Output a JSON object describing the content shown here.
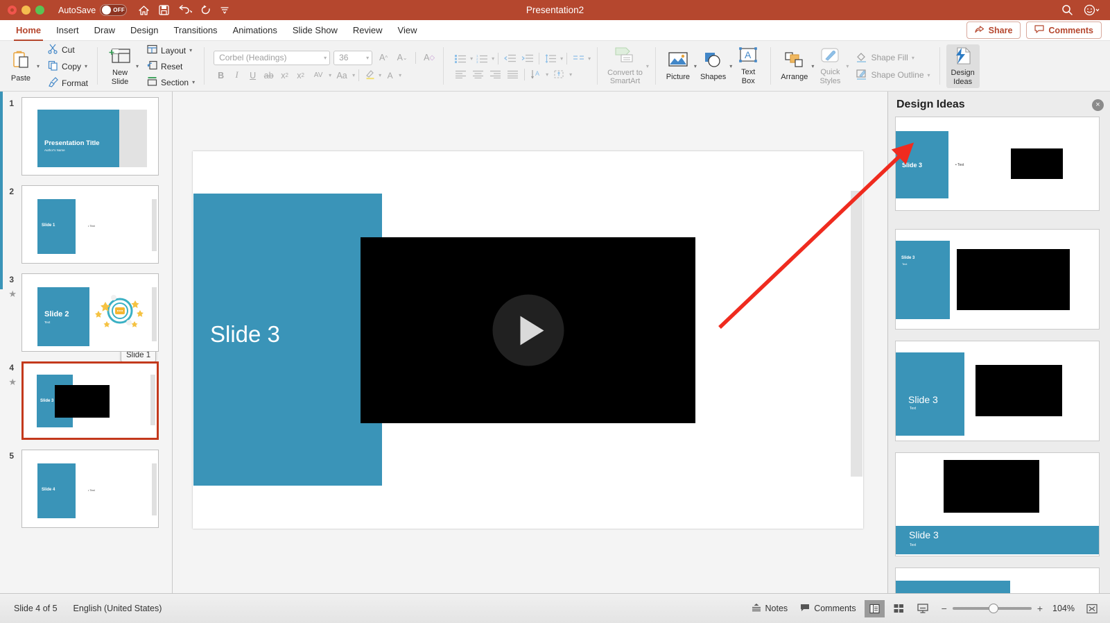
{
  "titlebar": {
    "autosave_label": "AutoSave",
    "autosave_state": "OFF",
    "document_title": "Presentation2",
    "icons": [
      "home-icon",
      "save-icon",
      "undo-icon",
      "redo-icon",
      "customize-toolbar-icon"
    ],
    "right_icons": [
      "search-icon",
      "account-icon"
    ]
  },
  "ribbon_tabs": [
    {
      "label": "Home",
      "active": true
    },
    {
      "label": "Insert",
      "active": false
    },
    {
      "label": "Draw",
      "active": false
    },
    {
      "label": "Design",
      "active": false
    },
    {
      "label": "Transitions",
      "active": false
    },
    {
      "label": "Animations",
      "active": false
    },
    {
      "label": "Slide Show",
      "active": false
    },
    {
      "label": "Review",
      "active": false
    },
    {
      "label": "View",
      "active": false
    }
  ],
  "tabs_right": {
    "share_label": "Share",
    "comments_label": "Comments"
  },
  "ribbon": {
    "clipboard": {
      "paste_label": "Paste",
      "cut_label": "Cut",
      "copy_label": "Copy",
      "format_label": "Format"
    },
    "slides": {
      "new_slide_label": "New\nSlide",
      "new_slide_line1": "New",
      "new_slide_line2": "Slide",
      "layout_label": "Layout",
      "reset_label": "Reset",
      "section_label": "Section"
    },
    "font": {
      "font_name": "Corbel (Headings)",
      "font_size": "36",
      "grow_font": "A",
      "shrink_font": "A",
      "clear_formatting": "A",
      "bold": "B",
      "italic": "I",
      "underline": "U",
      "strikethrough": "ab",
      "superscript": "x",
      "subscript": "x",
      "character_spacing": "AV",
      "change_case": "Aa",
      "highlight": "highlight-icon",
      "font_color": "A"
    },
    "smartart": {
      "convert_label_line1": "Convert to",
      "convert_label_line2": "SmartArt"
    },
    "insert": {
      "picture_label": "Picture",
      "shapes_label": "Shapes",
      "textbox_line1": "Text",
      "textbox_line2": "Box"
    },
    "drawing": {
      "arrange_label": "Arrange",
      "quick_styles_line1": "Quick",
      "quick_styles_line2": "Styles",
      "shape_fill_label": "Shape Fill",
      "shape_outline_label": "Shape Outline"
    },
    "designer": {
      "design_ideas_line1": "Design",
      "design_ideas_line2": "Ideas"
    }
  },
  "slide_panel": {
    "tooltip": "Slide 1",
    "slides": [
      {
        "number": "1",
        "title": "Presentation Title",
        "subtitle": "Author's Name",
        "layout": "title",
        "selected": false,
        "animated": false
      },
      {
        "number": "2",
        "title": "Slide 1",
        "bullet": "Text",
        "layout": "text",
        "selected": false,
        "animated": false
      },
      {
        "number": "3",
        "title": "Slide 2",
        "subtitle": "Text",
        "layout": "graphic",
        "selected": false,
        "animated": true
      },
      {
        "number": "4",
        "title": "Slide 3",
        "subtitle": "",
        "layout": "video",
        "selected": true,
        "animated": true
      },
      {
        "number": "5",
        "title": "Slide 4",
        "bullet": "Text",
        "layout": "text",
        "selected": false,
        "animated": false
      }
    ]
  },
  "canvas": {
    "slide_title": "Slide 3",
    "video_placeholder": "black-video-frame",
    "play_button": "play-icon"
  },
  "design_ideas": {
    "panel_title": "Design Ideas",
    "close_label": "×",
    "cards": [
      {
        "title": "Slide 3",
        "bullet": "Text",
        "variant": "left-panel-bullet-right-video"
      },
      {
        "title": "Slide 3",
        "subtitle": "Text",
        "variant": "left-panel-small-title-large-video"
      },
      {
        "title": "Slide 3",
        "subtitle": "Text",
        "variant": "left-panel-big-title-video"
      },
      {
        "title": "Slide 3",
        "subtitle": "Text",
        "variant": "top-video-bottom-band"
      },
      {
        "title": "",
        "subtitle": "",
        "variant": "top-band-partial"
      }
    ]
  },
  "status_bar": {
    "slide_counter": "Slide 4 of 5",
    "language": "English (United States)",
    "notes_label": "Notes",
    "comments_label": "Comments",
    "views": [
      "normal-view-icon",
      "slide-sorter-icon",
      "reading-view-icon"
    ],
    "zoom_out": "−",
    "zoom_in": "+",
    "zoom_percent": "104%",
    "fit_slide": "fit-to-window-icon"
  },
  "colors": {
    "title_bar": "#b5472e",
    "accent_blue": "#3a94b8",
    "selection_red": "#c3391c",
    "arrow_red": "#ef2b1f"
  }
}
